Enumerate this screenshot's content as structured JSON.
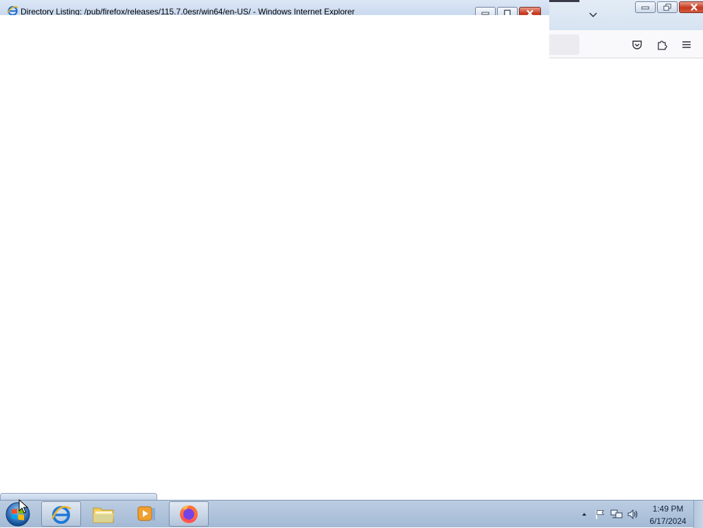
{
  "firefox_window": {
    "toolbar_icons": [
      "pocket-icon",
      "extensions-icon",
      "menu-icon"
    ]
  },
  "ie_window": {
    "title": "Directory Listing: /pub/firefox/releases/115.7.0esr/win64/en-US/ - Windows Internet Explorer"
  },
  "taskbar": {
    "pinned_apps": [
      "internet-explorer",
      "windows-explorer",
      "windows-media-player",
      "firefox"
    ],
    "clock": {
      "time": "1:49 PM",
      "date": "6/17/2024"
    }
  },
  "colors": {
    "taskbar": "#a3b9d4",
    "close_button": "#c4381f",
    "tab_accent": "#3a3a46"
  }
}
